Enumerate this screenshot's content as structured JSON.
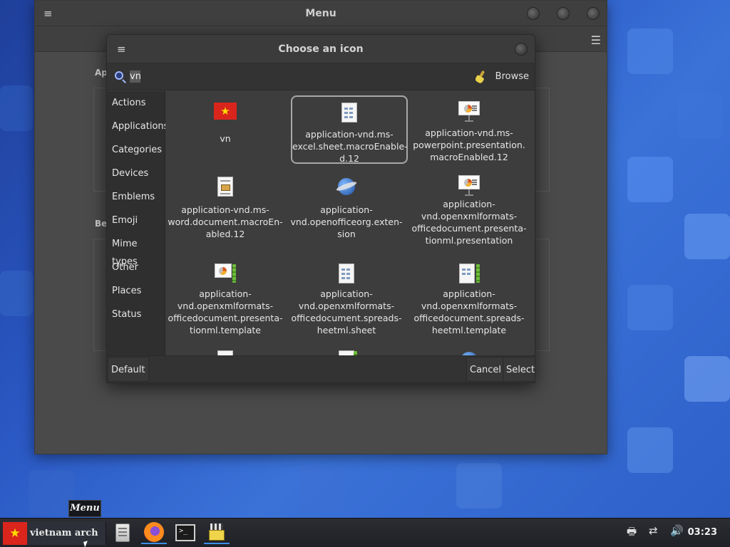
{
  "menu_window": {
    "title": "Menu",
    "fragment_top": "Ap",
    "fragment_bottom": "Be"
  },
  "dialog": {
    "title": "Choose an icon",
    "search": {
      "value": "vn",
      "placeholder": ""
    },
    "browse_label": "Browse",
    "categories": [
      "Actions",
      "Applications",
      "Categories",
      "Devices",
      "Emblems",
      "Emoji",
      "Mime types",
      "Other",
      "Places",
      "Status"
    ],
    "icons": [
      {
        "label": "vn",
        "icon": "vietnam-flag-icon"
      },
      {
        "label": "application-vnd.ms-\nexcel.sheet.macroEnable-\nd.12",
        "icon": "spreadsheet-icon",
        "selected": true
      },
      {
        "label": "application-vnd.ms-\npowerpoint.presentation.\nmacroEnabled.12",
        "icon": "presentation-icon"
      },
      {
        "label": "application-vnd.ms-\nword.document.macroEn-\nabled.12",
        "icon": "word-document-icon"
      },
      {
        "label": "application-\nvnd.openofficeorg.exten-\nsion",
        "icon": "extension-icon"
      },
      {
        "label": "application-\nvnd.openxmlformats-\nofficedocument.presenta-\ntionml.presentation",
        "icon": "presentation-icon"
      },
      {
        "label": "application-\nvnd.openxmlformats-\nofficedocument.presenta-\ntionml.template",
        "icon": "presentation-template-icon"
      },
      {
        "label": "application-\nvnd.openxmlformats-\nofficedocument.spreads-\nheetml.sheet",
        "icon": "spreadsheet-icon"
      },
      {
        "label": "application-\nvnd.openxmlformats-\nofficedocument.spreads-\nheetml.template",
        "icon": "spreadsheet-template-icon"
      }
    ],
    "footer": {
      "default_label": "Default",
      "cancel_label": "Cancel",
      "select_label": "Select"
    }
  },
  "taskbar": {
    "tooltip": "Menu",
    "start_label": "vietnam arch",
    "launchers": [
      "file-manager-icon",
      "firefox-icon",
      "terminal-icon",
      "icon-editor-icon"
    ],
    "tray_icons": [
      "printer-icon",
      "network-icon",
      "volume-icon"
    ],
    "clock": "03:23"
  },
  "colors": {
    "flag_red": "#da251d",
    "flag_star": "#ffdd00",
    "dialog_bg": "#3d3d3d",
    "sidebar_bg": "#2f2f2f",
    "desktop_blue": "#2a58c4"
  }
}
